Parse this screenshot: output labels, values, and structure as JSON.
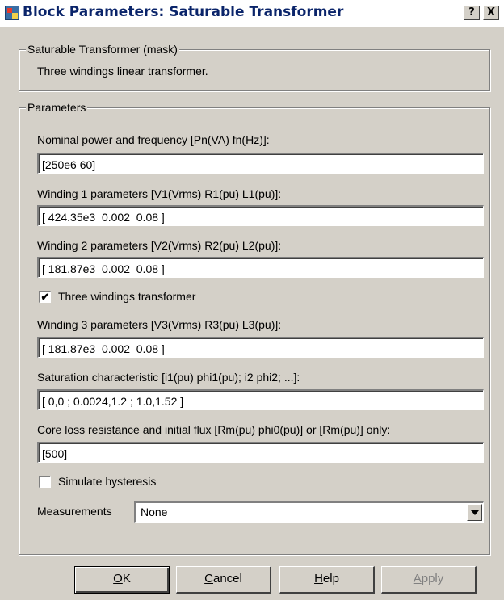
{
  "window": {
    "title": "Block Parameters: Saturable Transformer",
    "help_glyph": "?",
    "close_glyph": "X"
  },
  "mask": {
    "legend": "Saturable Transformer (mask)",
    "description": "Three windings linear transformer."
  },
  "parameters": {
    "legend": "Parameters",
    "nominal": {
      "label": "Nominal power and frequency [Pn(VA) fn(Hz)]:",
      "value": "[250e6 60]"
    },
    "winding1": {
      "label": "Winding 1 parameters [V1(Vrms) R1(pu) L1(pu)]:",
      "value": "[ 424.35e3  0.002  0.08 ]"
    },
    "winding2": {
      "label": "Winding 2 parameters [V2(Vrms) R2(pu) L2(pu)]:",
      "value": "[ 181.87e3  0.002  0.08 ]"
    },
    "three_windings": {
      "label": "Three windings transformer",
      "checked": true,
      "mark": "✔"
    },
    "winding3": {
      "label": "Winding 3 parameters [V3(Vrms) R3(pu) L3(pu)]:",
      "value": "[ 181.87e3  0.002  0.08 ]"
    },
    "saturation": {
      "label": "Saturation characteristic [i1(pu) phi1(pu); i2 phi2; ...]:",
      "value": "[ 0,0 ; 0.0024,1.2 ; 1.0,1.52 ]"
    },
    "core_loss": {
      "label": "Core loss resistance and initial flux [Rm(pu) phi0(pu)] or [Rm(pu)] only:",
      "value": "[500]"
    },
    "hysteresis": {
      "label": "Simulate hysteresis",
      "checked": false
    },
    "measurements": {
      "label": "Measurements",
      "selected": "None"
    }
  },
  "buttons": {
    "ok": "OK",
    "cancel": "Cancel",
    "help": "Help",
    "apply": "Apply"
  },
  "colors": {
    "dialog_bg": "#d4d0c8",
    "title_text": "#0a246a",
    "disabled_text": "#808080"
  }
}
